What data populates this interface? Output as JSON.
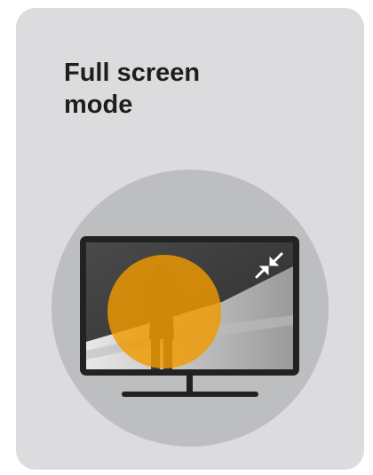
{
  "card": {
    "title": "Full screen\nmode"
  },
  "illustration": {
    "icon": "exit-fullscreen-icon",
    "colors": {
      "card_background": "#dcdcde",
      "circle_background": "#bdbec0",
      "monitor_frame": "#222222",
      "highlight": "#f29a00"
    }
  }
}
